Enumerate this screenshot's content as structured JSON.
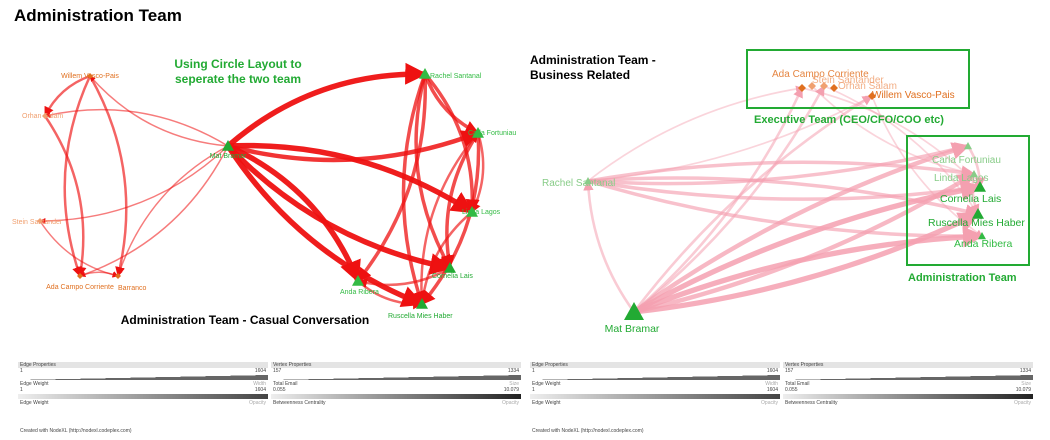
{
  "page_title": "Administration Team",
  "left_graph": {
    "annotation": [
      "Using Circle Layout to",
      "seperate the two team"
    ],
    "caption": "Administration Team - Casual Conversation",
    "nodes": [
      {
        "id": "mat",
        "label": "Mat Bramar",
        "color": "#22aa33",
        "shape": "triangle"
      },
      {
        "id": "willem",
        "label": "Willem Vasco-Pais",
        "color": "#e07020",
        "shape": "diamond"
      },
      {
        "id": "orhan",
        "label": "Orhan Salam",
        "color": "#f0a070",
        "shape": "diamond"
      },
      {
        "id": "stein",
        "label": "Stein Santander",
        "color": "#f0a070",
        "shape": "diamond"
      },
      {
        "id": "ada",
        "label": "Ada Campo Corriente",
        "color": "#e07020",
        "shape": "diamond"
      },
      {
        "id": "barranco",
        "label": "Barranco",
        "color": "#e07020",
        "shape": "diamond"
      },
      {
        "id": "rachel",
        "label": "Rachel Santanal",
        "color": "#33bb44",
        "shape": "triangle"
      },
      {
        "id": "carla",
        "label": "Carla Fortuniau",
        "color": "#33bb44",
        "shape": "triangle"
      },
      {
        "id": "linda",
        "label": "Linda Lagos",
        "color": "#33bb44",
        "shape": "triangle"
      },
      {
        "id": "cornelia",
        "label": "Cornelia Lais",
        "color": "#22aa33",
        "shape": "triangle"
      },
      {
        "id": "anda",
        "label": "Anda Ribera",
        "color": "#33bb44",
        "shape": "triangle"
      },
      {
        "id": "ruscella",
        "label": "Ruscella Mies Haber",
        "color": "#22aa33",
        "shape": "triangle"
      }
    ],
    "edges": [
      {
        "from": "mat",
        "to": "rachel",
        "weight": 5
      },
      {
        "from": "mat",
        "to": "carla",
        "weight": 4
      },
      {
        "from": "mat",
        "to": "linda",
        "weight": 5
      },
      {
        "from": "mat",
        "to": "cornelia",
        "weight": 5
      },
      {
        "from": "mat",
        "to": "anda",
        "weight": 5
      },
      {
        "from": "mat",
        "to": "ruscella",
        "weight": 5
      },
      {
        "from": "mat",
        "to": "willem",
        "weight": 1
      },
      {
        "from": "mat",
        "to": "orhan",
        "weight": 1
      },
      {
        "from": "mat",
        "to": "ada",
        "weight": 1
      },
      {
        "from": "mat",
        "to": "barranco",
        "weight": 1
      },
      {
        "from": "mat",
        "to": "stein",
        "weight": 1
      },
      {
        "from": "willem",
        "to": "ada",
        "weight": 2
      },
      {
        "from": "willem",
        "to": "barranco",
        "weight": 2
      },
      {
        "from": "willem",
        "to": "orhan",
        "weight": 2
      },
      {
        "from": "orhan",
        "to": "ada",
        "weight": 2
      },
      {
        "from": "stein",
        "to": "barranco",
        "weight": 1
      },
      {
        "from": "ada",
        "to": "barranco",
        "weight": 1
      },
      {
        "from": "rachel",
        "to": "carla",
        "weight": 3
      },
      {
        "from": "rachel",
        "to": "linda",
        "weight": 3
      },
      {
        "from": "rachel",
        "to": "cornelia",
        "weight": 3
      },
      {
        "from": "rachel",
        "to": "anda",
        "weight": 3
      },
      {
        "from": "rachel",
        "to": "ruscella",
        "weight": 3
      },
      {
        "from": "carla",
        "to": "linda",
        "weight": 2
      },
      {
        "from": "carla",
        "to": "cornelia",
        "weight": 3
      },
      {
        "from": "carla",
        "to": "ruscella",
        "weight": 3
      },
      {
        "from": "linda",
        "to": "ruscella",
        "weight": 2
      },
      {
        "from": "cornelia",
        "to": "anda",
        "weight": 2
      },
      {
        "from": "anda",
        "to": "ruscella",
        "weight": 2
      },
      {
        "from": "ruscella",
        "to": "carla",
        "weight": 2
      }
    ]
  },
  "right_graph": {
    "caption": [
      "Administration Team -",
      "Business Related"
    ],
    "group_executive": "Executive Team (CEO/CFO/COO etc)",
    "group_admin": "Administration Team",
    "overlap_labels": [
      "Ada Campo Corriente",
      "Stein Santander",
      "Orhan Salam"
    ],
    "nodes": [
      {
        "id": "mat",
        "label": "Mat Bramar",
        "color": "#22aa33",
        "shape": "triangle",
        "size": "large"
      },
      {
        "id": "rachel",
        "label": "Rachel Santanal",
        "color": "#88cc88",
        "shape": "triangle",
        "size": "small"
      },
      {
        "id": "willem",
        "label": "Willem Vasco-Pais",
        "color": "#e07020",
        "shape": "diamond",
        "size": "small"
      },
      {
        "id": "ada",
        "label": "",
        "color": "#e07020",
        "shape": "diamond",
        "size": "small"
      },
      {
        "id": "stein",
        "label": "",
        "color": "#f0a070",
        "shape": "diamond",
        "size": "small"
      },
      {
        "id": "orhan",
        "label": "",
        "color": "#f0a070",
        "shape": "diamond",
        "size": "small"
      },
      {
        "id": "barranco",
        "label": "",
        "color": "#e07020",
        "shape": "diamond",
        "size": "small"
      },
      {
        "id": "carla",
        "label": "Carla Fortuniau",
        "color": "#88cc88",
        "shape": "triangle",
        "size": "small"
      },
      {
        "id": "linda",
        "label": "Linda Lagos",
        "color": "#88cc88",
        "shape": "triangle",
        "size": "small"
      },
      {
        "id": "cornelia",
        "label": "Cornelia Lais",
        "color": "#22aa33",
        "shape": "triangle",
        "size": "medium"
      },
      {
        "id": "ruscella",
        "label": "Ruscella Mies Haber",
        "color": "#22aa33",
        "shape": "triangle",
        "size": "medium"
      },
      {
        "id": "anda",
        "label": "Anda Ribera",
        "color": "#33bb44",
        "shape": "triangle",
        "size": "small"
      }
    ],
    "edges": [
      {
        "from": "mat",
        "to": "carla",
        "weight": 4
      },
      {
        "from": "mat",
        "to": "linda",
        "weight": 4
      },
      {
        "from": "mat",
        "to": "cornelia",
        "weight": 5
      },
      {
        "from": "mat",
        "to": "ruscella",
        "weight": 5
      },
      {
        "from": "mat",
        "to": "anda",
        "weight": 5
      },
      {
        "from": "mat",
        "to": "ada",
        "weight": 2
      },
      {
        "from": "mat",
        "to": "willem",
        "weight": 2
      },
      {
        "from": "mat",
        "to": "orhan",
        "weight": 2
      },
      {
        "from": "mat",
        "to": "rachel",
        "weight": 2
      },
      {
        "from": "rachel",
        "to": "carla",
        "weight": 3
      },
      {
        "from": "rachel",
        "to": "linda",
        "weight": 3
      },
      {
        "from": "rachel",
        "to": "cornelia",
        "weight": 3
      },
      {
        "from": "rachel",
        "to": "ruscella",
        "weight": 3
      },
      {
        "from": "rachel",
        "to": "anda",
        "weight": 3
      },
      {
        "from": "rachel",
        "to": "ada",
        "weight": 1
      },
      {
        "from": "rachel",
        "to": "willem",
        "weight": 1
      },
      {
        "from": "carla",
        "to": "cornelia",
        "weight": 2
      },
      {
        "from": "linda",
        "to": "ruscella",
        "weight": 2
      },
      {
        "from": "ada",
        "to": "cornelia",
        "weight": 1
      },
      {
        "from": "willem",
        "to": "anda",
        "weight": 1
      },
      {
        "from": "orhan",
        "to": "ruscella",
        "weight": 1
      },
      {
        "from": "stein",
        "to": "linda",
        "weight": 1
      }
    ]
  },
  "legend": {
    "edge_properties": "Edge Properties",
    "vertex_properties": "Vertex Properties",
    "edge_weight": "Edge Weight",
    "width": "Width",
    "opacity": "Opacity",
    "total_email": "Total Email",
    "size": "Size",
    "betweenness": "Betweenness Centrality",
    "edge_min": "1",
    "edge_max": "1604",
    "email_min": "157",
    "email_max": "1334",
    "bc_min": "0.055",
    "bc_max": "10.079",
    "credit": "Created with NodeXL (http://nodexl.codeplex.com)"
  }
}
